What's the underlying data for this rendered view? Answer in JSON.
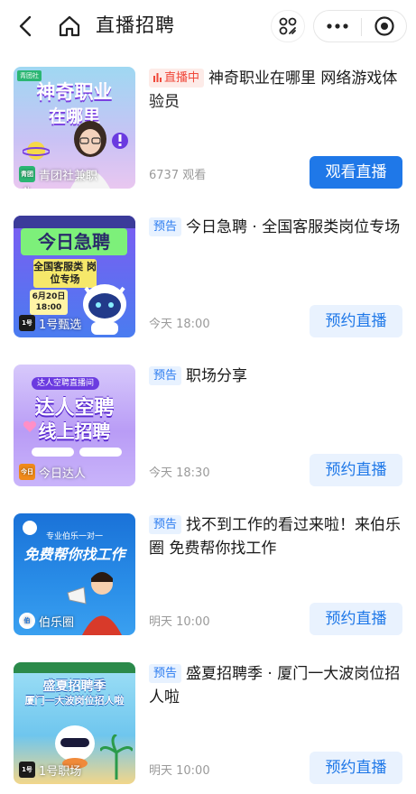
{
  "header": {
    "title": "直播招聘"
  },
  "items": [
    {
      "badge": "直播中",
      "title": "神奇职业在哪里 网络游戏体验员",
      "meta": "6737 观看",
      "action": "观看直播",
      "poster": {
        "line1": "神奇职业",
        "line2": "在哪里",
        "source": "青团社兼职",
        "logo": "青团社",
        "corner": "青团社"
      }
    },
    {
      "badge": "预告",
      "title": "今日急聘 · 全国客服类岗位专场",
      "meta": "今天 18:00",
      "action": "预约直播",
      "poster": {
        "line1": "今日急聘",
        "line2": "全国客服类 岗位专场",
        "source": "1号甄选",
        "logo": "1号",
        "date": "6月20日 18:00"
      }
    },
    {
      "badge": "预告",
      "title": "职场分享",
      "meta": "今天 18:30",
      "action": "预约直播",
      "poster": {
        "line1": "达人空聘",
        "line2": "线上招聘",
        "source": "今日达人",
        "logo": "今日",
        "tag": "达人空聘直播间"
      }
    },
    {
      "badge": "预告",
      "title": "找不到工作的看过来啦！来伯乐圈 免费帮你找工作",
      "meta": "明天 10:00",
      "action": "预约直播",
      "poster": {
        "line1": "专业伯乐一对一",
        "line2": "免费帮你找工作",
        "source": "伯乐圈",
        "logo": "伯"
      }
    },
    {
      "badge": "预告",
      "title": "盛夏招聘季 · 厦门一大波岗位招人啦",
      "meta": "明天 10:00",
      "action": "预约直播",
      "poster": {
        "line1": "盛夏招聘季",
        "line2": "厦门一大波岗位招人啦",
        "source": "1号职场",
        "logo": "1号"
      }
    }
  ]
}
